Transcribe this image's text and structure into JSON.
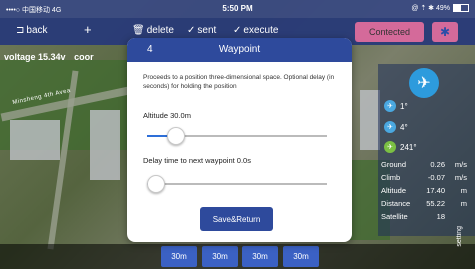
{
  "status_bar": {
    "carrier": "••••○ 中国移动 4G",
    "time": "5:50 PM",
    "right": "@ ⇡ ✱ 49%",
    "battery_percent": 49
  },
  "toolbar": {
    "back": "back",
    "add": "+",
    "delete": "delete",
    "sent": "sent",
    "execute": "execute",
    "connected": "Contected",
    "bluetooth": "✱"
  },
  "overlay": {
    "voltage_label": "voltage",
    "voltage_value": "15.34v",
    "voltage_cut": "coor",
    "road": "Minsheng 4th Avea"
  },
  "dialog": {
    "number": "4",
    "title": "Waypoint",
    "description": "Proceeds to a position three-dimensional space. Optional delay (in seconds) for holding the position",
    "altitude_label": "Altitude 30.0m",
    "delay_label": "Delay time to next waypoint 0.0s",
    "altitude_slider_level": 0.12,
    "delay_slider_level": 0.0,
    "save_button": "Save&Return"
  },
  "telemetry": {
    "plane_icon": "airplane-icon",
    "orientation": [
      {
        "value": "1°",
        "color": "#4aa8e0"
      },
      {
        "value": "4°",
        "color": "#4aa8e0"
      },
      {
        "value": "241°",
        "color": "#7bc043"
      }
    ],
    "stats": [
      {
        "label": "Ground",
        "value": "0.26",
        "unit": "m/s"
      },
      {
        "label": "Climb",
        "value": "-0.07",
        "unit": "m/s"
      },
      {
        "label": "Altitude",
        "value": "17.40",
        "unit": "m"
      },
      {
        "label": "Distance",
        "value": "55.22",
        "unit": "m"
      },
      {
        "label": "Satellite",
        "value": "18",
        "unit": ""
      }
    ]
  },
  "bottom_buttons": [
    "30m",
    "30m",
    "30m",
    "30m"
  ],
  "vertical_text": "setting"
}
